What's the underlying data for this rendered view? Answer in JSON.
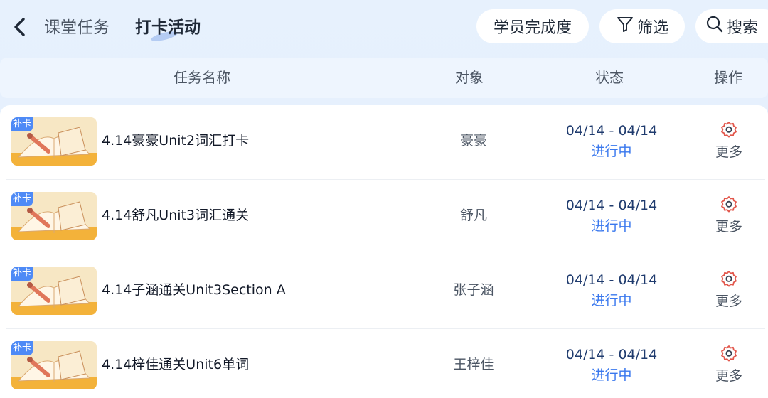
{
  "header": {
    "back_icon": "chevron-left-icon",
    "tabs": [
      {
        "label": "课堂任务",
        "active": false
      },
      {
        "label": "打卡活动",
        "active": true
      }
    ],
    "buttons": {
      "progress_label": "学员完成度",
      "filter_label": "筛选",
      "filter_icon": "filter-icon",
      "search_label": "搜索",
      "search_icon": "search-icon"
    }
  },
  "table": {
    "columns": {
      "name": "任务名称",
      "target": "对象",
      "status": "状态",
      "action": "操作"
    },
    "rows": [
      {
        "tag": "补卡",
        "name": "4.14豪豪Unit2词汇打卡",
        "target": "豪豪",
        "date_range": "04/14 - 04/14",
        "status": "进行中",
        "action_label": "更多"
      },
      {
        "tag": "补卡",
        "name": "4.14舒凡Unit3词汇通关",
        "target": "舒凡",
        "date_range": "04/14 - 04/14",
        "status": "进行中",
        "action_label": "更多"
      },
      {
        "tag": "补卡",
        "name": "4.14子涵通关Unit3Section A",
        "target": "张子涵",
        "date_range": "04/14 - 04/14",
        "status": "进行中",
        "action_label": "更多"
      },
      {
        "tag": "补卡",
        "name": "4.14梓佳通关Unit6单词",
        "target": "王梓佳",
        "date_range": "04/14 - 04/14",
        "status": "进行中",
        "action_label": "更多"
      }
    ]
  },
  "colors": {
    "accent": "#3a78ee",
    "tag_bg": "#4e8af6",
    "background": "#e5f0fc"
  }
}
